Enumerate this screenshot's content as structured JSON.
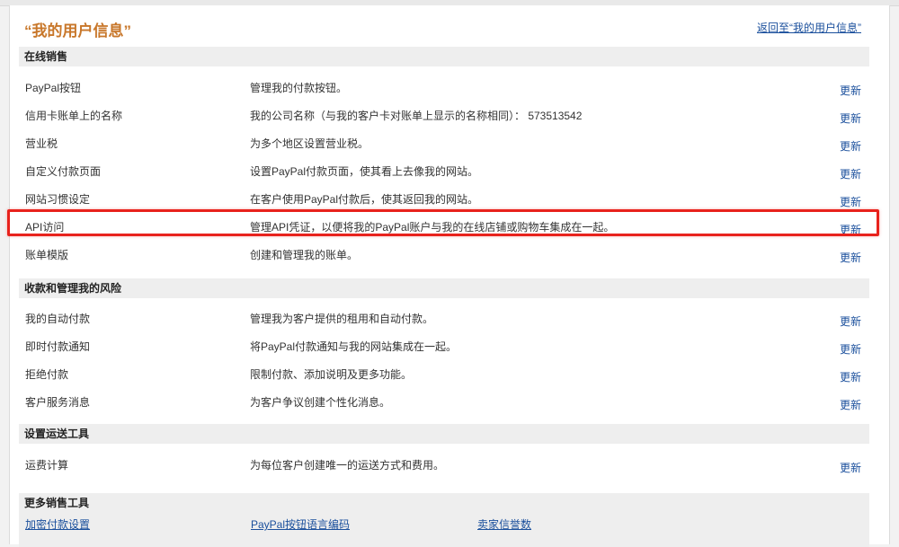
{
  "page": {
    "title": "“我的用户信息”",
    "back_link": "返回至“我的用户信息”"
  },
  "update_label": "更新",
  "sections": [
    {
      "header": "在线销售",
      "rows": [
        {
          "label": "PayPal按钮",
          "desc": "管理我的付款按钮。",
          "action": "更新"
        },
        {
          "label": "信用卡账单上的名称",
          "desc": "我的公司名称（与我的客户卡对账单上显示的名称相同）： 573513542",
          "action": "更新"
        },
        {
          "label": "营业税",
          "desc": "为多个地区设置营业税。",
          "action": "更新"
        },
        {
          "label": "自定义付款页面",
          "desc": "设置PayPal付款页面，使其看上去像我的网站。",
          "action": "更新"
        },
        {
          "label": "网站习惯设定",
          "desc": "在客户使用PayPal付款后，使其返回我的网站。",
          "action": "更新"
        },
        {
          "label": "API访问",
          "desc": "管理API凭证，以便将我的PayPal账户与我的在线店铺或购物车集成在一起。",
          "action": "更新"
        },
        {
          "label": "账单模版",
          "desc": "创建和管理我的账单。",
          "action": "更新"
        }
      ]
    },
    {
      "header": "收款和管理我的风险",
      "rows": [
        {
          "label": "我的自动付款",
          "desc": "管理我为客户提供的租用和自动付款。",
          "action": "更新"
        },
        {
          "label": "即时付款通知",
          "desc": "将PayPal付款通知与我的网站集成在一起。",
          "action": "更新"
        },
        {
          "label": "拒绝付款",
          "desc": "限制付款、添加说明及更多功能。",
          "action": "更新"
        },
        {
          "label": "客户服务消息",
          "desc": "为客户争议创建个性化消息。",
          "action": "更新"
        }
      ]
    },
    {
      "header": "设置运送工具",
      "rows": [
        {
          "label": "运费计算",
          "desc": "为每位客户创建唯一的运送方式和费用。",
          "action": "更新"
        }
      ]
    }
  ],
  "more_tools": {
    "header": "更多销售工具",
    "links": [
      "加密付款设置",
      "PayPal按钮语言编码",
      "卖家信誉数"
    ]
  },
  "colors": {
    "title": "#c8772a",
    "link": "#1a4f9c",
    "highlight": "#e8221c",
    "section_bg": "#eeeeee"
  }
}
